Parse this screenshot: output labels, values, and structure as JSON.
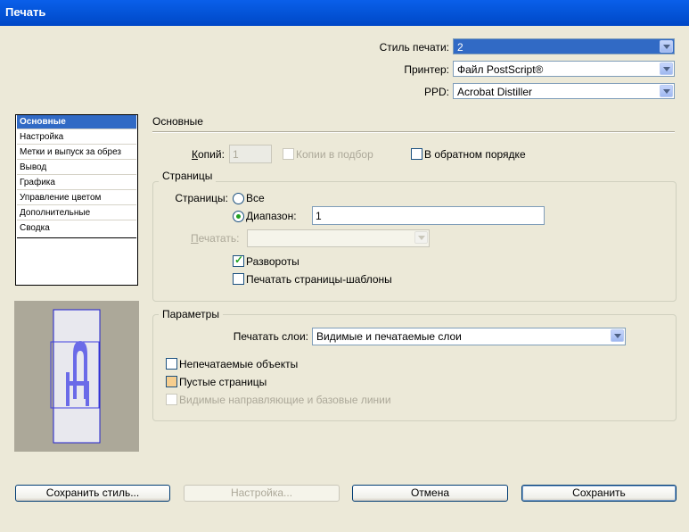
{
  "window": {
    "title": "Печать"
  },
  "top": {
    "style_label": "Стиль печати:",
    "style_value": "2",
    "printer_label": "Принтер:",
    "printer_value": "Файл PostScript®",
    "ppd_label": "PPD:",
    "ppd_value": "Acrobat Distiller"
  },
  "sidebar": {
    "items": [
      {
        "label": "Основные"
      },
      {
        "label": "Настройка"
      },
      {
        "label": "Метки и выпуск за обрез"
      },
      {
        "label": "Вывод"
      },
      {
        "label": "Графика"
      },
      {
        "label": "Управление цветом"
      },
      {
        "label": "Дополнительные"
      },
      {
        "label": "Сводка"
      }
    ]
  },
  "main": {
    "section_title": "Основные",
    "copies_label": "Копий:",
    "copies_value": "1",
    "collate_label": "Копии в подбор",
    "reverse_label": "В обратном порядке",
    "pages_group": "Страницы",
    "pages_label": "Страницы:",
    "all_label": "Все",
    "range_label": "Диапазон:",
    "range_value": "1",
    "print_label": "Печатать:",
    "spreads_label": "Развороты",
    "master_pages_label": "Печатать страницы-шаблоны",
    "options_group": "Параметры",
    "layers_label": "Печатать слои:",
    "layers_value": "Видимые и печатаемые слои",
    "nonprint_label": "Непечатаемые объекты",
    "blank_label": "Пустые страницы",
    "guides_label": "Видимые направляющие и базовые линии"
  },
  "buttons": {
    "save_style": "Сохранить стиль...",
    "setup": "Настройка...",
    "cancel": "Отмена",
    "save": "Сохранить"
  },
  "colors": {
    "accent": "#316AC5",
    "titlebar": "#0454D8",
    "dialog_bg": "#ECE9D8"
  }
}
